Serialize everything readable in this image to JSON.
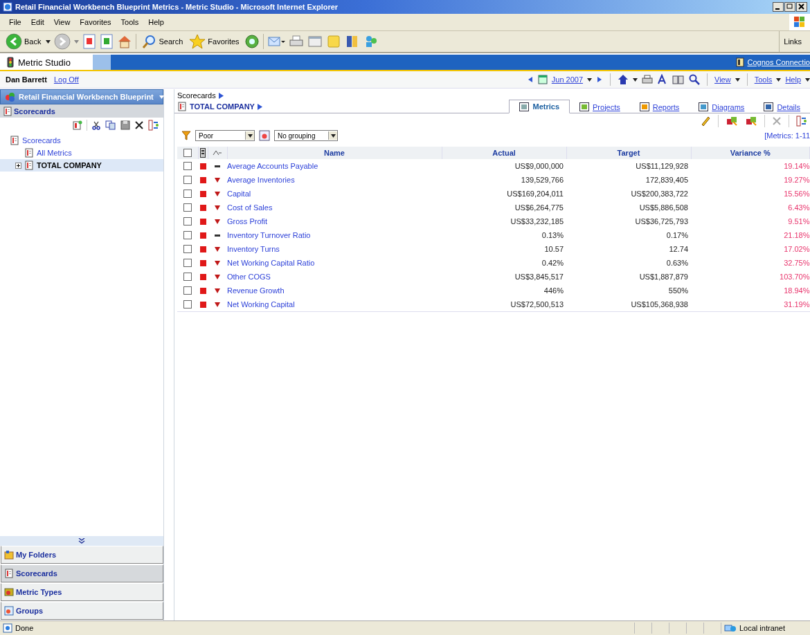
{
  "window": {
    "title": "Retail Financial Workbench Blueprint Metrics - Metric Studio - Microsoft Internet Explorer"
  },
  "menu": [
    "File",
    "Edit",
    "View",
    "Favorites",
    "Tools",
    "Help"
  ],
  "toolbar": {
    "back": "Back",
    "search": "Search",
    "favorites": "Favorites",
    "links": "Links"
  },
  "app": {
    "name": "Metric Studio",
    "connection": "Cognos Connectio",
    "user": "Dan Barrett",
    "logoff": "Log Off",
    "period": "Jun 2007",
    "view": "View",
    "tools": "Tools",
    "help": "Help"
  },
  "sidebar": {
    "package": "Retail Financial Workbench Blueprint",
    "heading": "Scorecards",
    "tree": [
      {
        "label": "Scorecards",
        "selected": false,
        "collapsed": false,
        "children": [
          {
            "label": "All Metrics",
            "selected": false,
            "collapsed": false
          },
          {
            "label": "TOTAL COMPANY",
            "selected": true,
            "collapsed": true
          }
        ]
      }
    ],
    "sections": [
      {
        "label": "My Folders",
        "selected": false
      },
      {
        "label": "Scorecards",
        "selected": true
      },
      {
        "label": "Metric Types",
        "selected": false
      },
      {
        "label": "Groups",
        "selected": false
      }
    ]
  },
  "breadcrumb": [
    "Scorecards",
    "TOTAL COMPANY"
  ],
  "tabs": [
    {
      "label": "Metrics",
      "selected": true
    },
    {
      "label": "Projects",
      "selected": false
    },
    {
      "label": "Reports",
      "selected": false
    },
    {
      "label": "Diagrams",
      "selected": false
    },
    {
      "label": "Details",
      "selected": false
    }
  ],
  "filter": {
    "status": "Poor",
    "grouping": "No grouping",
    "count": "[Metrics: 1-11"
  },
  "table": {
    "columns": [
      "Name",
      "Actual",
      "Target",
      "Variance %"
    ],
    "all_checked": false,
    "rows": [
      {
        "checked": false,
        "color": "#e01818",
        "kind": "flat",
        "name": "Average Accounts Payable",
        "actual": "US$9,000,000",
        "target": "US$11,129,928",
        "variance": "19.14%"
      },
      {
        "checked": false,
        "color": "#e01818",
        "kind": "down",
        "name": "Average Inventories",
        "actual": "139,529,766",
        "target": "172,839,405",
        "variance": "19.27%"
      },
      {
        "checked": false,
        "color": "#e01818",
        "kind": "down",
        "name": "Capital",
        "actual": "US$169,204,011",
        "target": "US$200,383,722",
        "variance": "15.56%"
      },
      {
        "checked": false,
        "color": "#e01818",
        "kind": "down",
        "name": "Cost of Sales",
        "actual": "US$6,264,775",
        "target": "US$5,886,508",
        "variance": "6.43%"
      },
      {
        "checked": false,
        "color": "#e01818",
        "kind": "down",
        "name": "Gross Profit",
        "actual": "US$33,232,185",
        "target": "US$36,725,793",
        "variance": "9.51%"
      },
      {
        "checked": false,
        "color": "#e01818",
        "kind": "flat",
        "name": "Inventory Turnover Ratio",
        "actual": "0.13%",
        "target": "0.17%",
        "variance": "21.18%"
      },
      {
        "checked": false,
        "color": "#e01818",
        "kind": "down",
        "name": "Inventory Turns",
        "actual": "10.57",
        "target": "12.74",
        "variance": "17.02%"
      },
      {
        "checked": false,
        "color": "#e01818",
        "kind": "down",
        "name": "Net Working Capital Ratio",
        "actual": "0.42%",
        "target": "0.63%",
        "variance": "32.75%"
      },
      {
        "checked": false,
        "color": "#e01818",
        "kind": "down",
        "name": "Other COGS",
        "actual": "US$3,845,517",
        "target": "US$1,887,879",
        "variance": "103.70%"
      },
      {
        "checked": false,
        "color": "#e01818",
        "kind": "down",
        "name": "Revenue Growth",
        "actual": "446%",
        "target": "550%",
        "variance": "18.94%"
      },
      {
        "checked": false,
        "color": "#e01818",
        "kind": "down",
        "name": "Net Working Capital",
        "actual": "US$72,500,513",
        "target": "US$105,368,938",
        "variance": "31.19%"
      }
    ]
  },
  "status_bar": {
    "message": "Done",
    "zone": "Local intranet"
  }
}
